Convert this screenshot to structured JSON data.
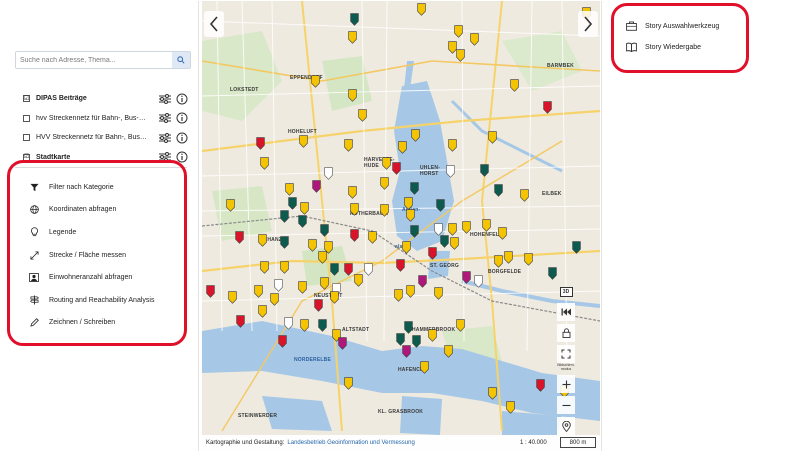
{
  "search": {
    "placeholder": "Suche nach Adresse, Thema..."
  },
  "layers": [
    {
      "label": "DIPAS Beiträge",
      "checked": "☑",
      "bold": true
    },
    {
      "label": "hvv Streckennetz für Bahn-, Bus-…",
      "checked": "",
      "bold": false
    },
    {
      "label": "HVV Streckennetz für Bahn-, Bus…",
      "checked": "",
      "bold": false
    },
    {
      "label": "Stadtkarte",
      "checked": "☑",
      "bold": true
    }
  ],
  "tools": [
    {
      "label": "Filter nach Kategorie",
      "icon": "filter-icon"
    },
    {
      "label": "Koordinaten abfragen",
      "icon": "globe-icon"
    },
    {
      "label": "Legende",
      "icon": "lightbulb-icon"
    },
    {
      "label": "Strecke / Fläche messen",
      "icon": "measure-icon"
    },
    {
      "label": "Einwohneranzahl abfragen",
      "icon": "population-icon"
    },
    {
      "label": "Routing and Reachability Analysis",
      "icon": "routing-icon"
    },
    {
      "label": "Zeichnen / Schreiben",
      "icon": "pencil-icon"
    }
  ],
  "story": [
    {
      "label": "Story Auswahlwerkzeug",
      "icon": "briefcase-icon"
    },
    {
      "label": "Story Wiedergabe",
      "icon": "book-icon"
    }
  ],
  "map": {
    "labels": {
      "eppendorf": "EPPENDORF",
      "barmbek": "BARMBEK",
      "lokstedt": "LOKSTEDT",
      "hoheluft": "HOHELUFT",
      "harvestehude": "HARVESTE-\nHUDE",
      "uhlenhorst": "UHLEN-\nHORST",
      "eilbek": "EILBEK",
      "rotherbaum": "ROTHERBAUM",
      "aussenalster": "Außen-",
      "alster": "alster",
      "hohenfelde": "HOHENFELDE",
      "stgeorg": "ST. GEORG",
      "borgfelde": "BORGFELDE",
      "altstadt": "ALTSTADT",
      "hammerbrook": "HAMMERBROOK",
      "hafencity": "HAFENCITY",
      "elbe": "NORDERELBE",
      "steinwerder": "STEINWERDER",
      "grasbrook": "KL. GRASBROOK",
      "neustadt": "NEUSTADT",
      "schanze": "SCHANZE"
    },
    "controls": {
      "badge": "3D",
      "note": "Bildschirm-\nmodus"
    },
    "footer": {
      "prefix": "Kartographie und Gestaltung:",
      "link": "Landesbetrieb Geoinformation und Vermessung",
      "scale": "1 : 40.000",
      "scale_bar": "800 m"
    },
    "pin_colors": {
      "yellow": "#f5c400",
      "red": "#d9142a",
      "teal": "#0c5b4e",
      "magenta": "#b0177a",
      "white": "#ffffff"
    }
  },
  "colors": {
    "accent_ring": "#e0102a",
    "search_button_bg": "#dfe9f6"
  }
}
